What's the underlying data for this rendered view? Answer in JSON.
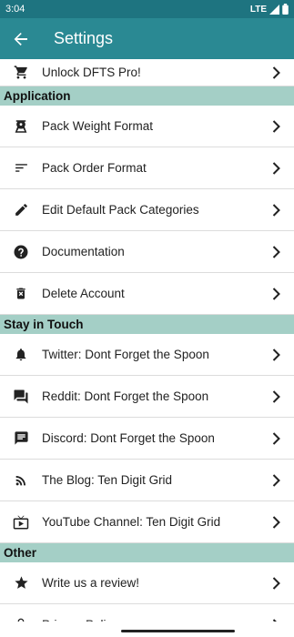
{
  "status": {
    "time": "3:04",
    "network": "LTE"
  },
  "appbar": {
    "title": "Settings"
  },
  "colors": {
    "appbar": "#2a8993",
    "statusbar": "#1e7480",
    "section": "#a4cfc6"
  },
  "unlock": {
    "label": "Unlock DFTS Pro!",
    "icon": "cart-icon"
  },
  "sections": {
    "application": "Application",
    "stay_in_touch": "Stay in Touch",
    "other": "Other"
  },
  "application_items": [
    {
      "label": "Pack Weight Format",
      "icon": "scale-icon"
    },
    {
      "label": "Pack Order Format",
      "icon": "sort-icon"
    },
    {
      "label": "Edit Default Pack Categories",
      "icon": "pencil-icon"
    },
    {
      "label": "Documentation",
      "icon": "help-icon"
    },
    {
      "label": "Delete Account",
      "icon": "trash-icon"
    }
  ],
  "touch_items": [
    {
      "label": "Twitter: Dont Forget the Spoon",
      "icon": "bell-icon"
    },
    {
      "label": "Reddit: Dont Forget the Spoon",
      "icon": "chat-icon"
    },
    {
      "label": "Discord: Dont Forget the Spoon",
      "icon": "message-icon"
    },
    {
      "label": "The Blog: Ten Digit Grid",
      "icon": "rss-icon"
    },
    {
      "label": "YouTube Channel: Ten Digit Grid",
      "icon": "tv-icon"
    }
  ],
  "other_items": [
    {
      "label": "Write us a review!",
      "icon": "star-icon"
    },
    {
      "label": "Privacy Policy",
      "icon": "lock-icon"
    }
  ]
}
